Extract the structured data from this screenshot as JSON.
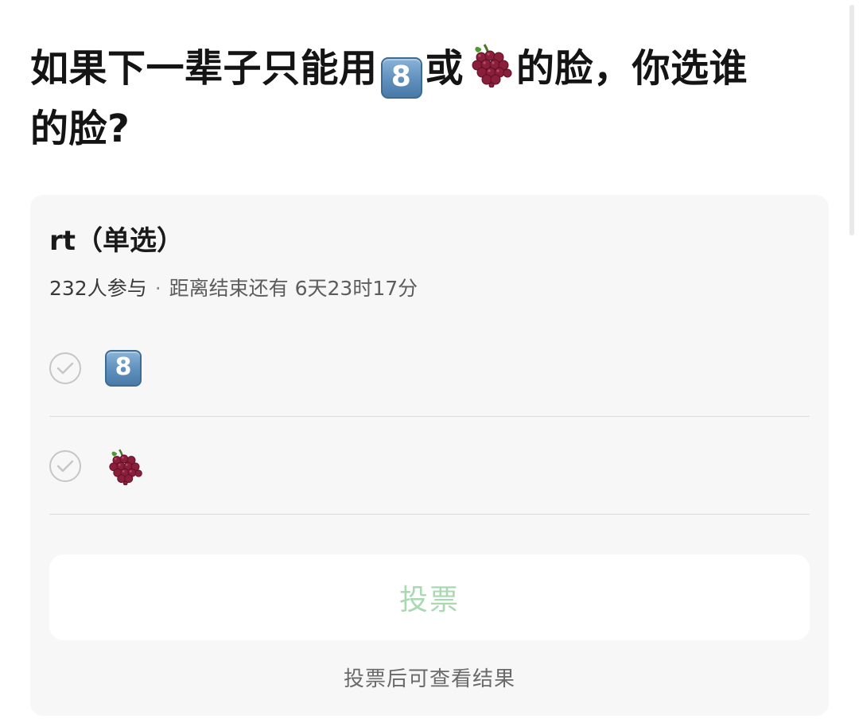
{
  "post": {
    "title_part1": "如果下一辈子只能用",
    "title_part2": "或",
    "title_part3": "的脸，你选谁",
    "title_line2": "的脸?",
    "emoji_a": "8",
    "emoji_a_name": "keycap-8",
    "emoji_b_name": "grapes"
  },
  "poll": {
    "title": "rt（单选）",
    "participants": "232人参与",
    "separator": "·",
    "time_remaining": "距离结束还有 6天23时17分",
    "options": [
      {
        "label": "8",
        "icon": "keycap-8"
      },
      {
        "label": "",
        "icon": "grapes"
      }
    ],
    "vote_button": "投票",
    "vote_hint": "投票后可查看结果"
  },
  "colors": {
    "vote_text": "#a9d9b1",
    "card_bg": "#f7f7f7",
    "keycap": "#5f8fbd",
    "grape": "#8a1f3c"
  }
}
